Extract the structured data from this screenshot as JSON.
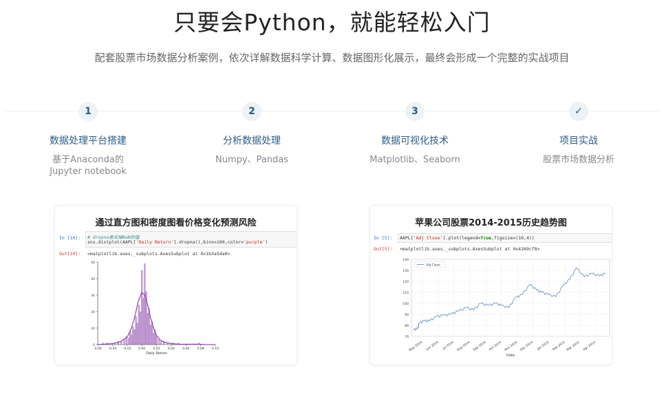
{
  "hero": {
    "title": "只要会Python，就能轻松入门",
    "subtitle": "配套股票市场数据分析案例，依次详解数据科学计算、数据图形化展示，最终会形成一个完整的实战项目"
  },
  "steps": [
    {
      "badge": "1",
      "title": "数据处理平台搭建",
      "desc_line1": "基于Anaconda的",
      "desc_line2": "Jupyter notebook"
    },
    {
      "badge": "2",
      "title": "分析数据处理",
      "desc_line1": "Numpy、Pandas",
      "desc_line2": ""
    },
    {
      "badge": "3",
      "title": "数据可视化技术",
      "desc_line1": "Matplotlib、Seaborn",
      "desc_line2": ""
    },
    {
      "badge": "✓",
      "title": "项目实战",
      "desc_line1": "股票市场数据分析",
      "desc_line2": ""
    }
  ],
  "cards": [
    {
      "title": "通过直方图和密度图看价格变化预测风险",
      "in_label": "In [10]:",
      "comment": "# dropna舍去掉NaN的值",
      "code_pre": "sns.distplot(AAPL[",
      "code_str": "'Daily Return'",
      "code_post": "].dropna(),bins=100,color=",
      "code_str2": "'purple'",
      "code_end": ")",
      "out_label": "Out[10]:",
      "out_text": "<matplotlib.axes._subplots.AxesSubplot at 0x1b3a5da0>"
    },
    {
      "title": "苹果公司股票2014-2015历史趋势图",
      "in_label": "In [5]:",
      "code_pre": "AAPL[",
      "code_str": "'Adj Close'",
      "code_post": "].plot(legend=",
      "code_kw": "True",
      "code_end": ",figsize=(10,4))",
      "out_label": "Out[5]:",
      "out_text": "<matplotlib.axes._subplots.AxesSubplot at 0x4269cf8>"
    }
  ],
  "chart_data": [
    {
      "type": "bar",
      "xlabel": "Daily Return",
      "ylabel": "",
      "xlim": [
        -0.06,
        0.1
      ],
      "ylim": [
        0,
        50
      ],
      "x_ticks": [
        "-0.06",
        "-0.04",
        "-0.02",
        "0.00",
        "0.02",
        "0.04",
        "0.06",
        "0.08",
        "0.10"
      ],
      "y_ticks": [
        "0",
        "10",
        "20",
        "30",
        "40",
        "50"
      ],
      "color": "#9b59b6",
      "bins": [
        {
          "x": -0.053,
          "y": 1
        },
        {
          "x": -0.047,
          "y": 1
        },
        {
          "x": -0.037,
          "y": 1
        },
        {
          "x": -0.032,
          "y": 2
        },
        {
          "x": -0.028,
          "y": 2
        },
        {
          "x": -0.024,
          "y": 3
        },
        {
          "x": -0.021,
          "y": 5
        },
        {
          "x": -0.018,
          "y": 4
        },
        {
          "x": -0.016,
          "y": 8
        },
        {
          "x": -0.014,
          "y": 6
        },
        {
          "x": -0.012,
          "y": 11
        },
        {
          "x": -0.01,
          "y": 9
        },
        {
          "x": -0.008,
          "y": 17
        },
        {
          "x": -0.006,
          "y": 13
        },
        {
          "x": -0.004,
          "y": 24
        },
        {
          "x": -0.002,
          "y": 20
        },
        {
          "x": 0.0,
          "y": 45
        },
        {
          "x": 0.002,
          "y": 28
        },
        {
          "x": 0.004,
          "y": 49
        },
        {
          "x": 0.006,
          "y": 32
        },
        {
          "x": 0.008,
          "y": 19
        },
        {
          "x": 0.01,
          "y": 22
        },
        {
          "x": 0.012,
          "y": 12
        },
        {
          "x": 0.014,
          "y": 14
        },
        {
          "x": 0.016,
          "y": 7
        },
        {
          "x": 0.018,
          "y": 9
        },
        {
          "x": 0.02,
          "y": 5
        },
        {
          "x": 0.023,
          "y": 3
        },
        {
          "x": 0.026,
          "y": 2
        },
        {
          "x": 0.03,
          "y": 2
        },
        {
          "x": 0.035,
          "y": 1
        },
        {
          "x": 0.042,
          "y": 1
        },
        {
          "x": 0.05,
          "y": 1
        },
        {
          "x": 0.078,
          "y": 1
        }
      ],
      "kde": [
        {
          "x": -0.06,
          "y": 0
        },
        {
          "x": -0.04,
          "y": 0.6
        },
        {
          "x": -0.03,
          "y": 1.6
        },
        {
          "x": -0.02,
          "y": 4.5
        },
        {
          "x": -0.015,
          "y": 9
        },
        {
          "x": -0.01,
          "y": 16
        },
        {
          "x": -0.005,
          "y": 26
        },
        {
          "x": 0.0,
          "y": 31.5
        },
        {
          "x": 0.004,
          "y": 30
        },
        {
          "x": 0.008,
          "y": 24
        },
        {
          "x": 0.012,
          "y": 16
        },
        {
          "x": 0.016,
          "y": 10
        },
        {
          "x": 0.02,
          "y": 5.5
        },
        {
          "x": 0.025,
          "y": 2.8
        },
        {
          "x": 0.03,
          "y": 1.5
        },
        {
          "x": 0.04,
          "y": 0.6
        },
        {
          "x": 0.05,
          "y": 0.3
        },
        {
          "x": 0.06,
          "y": 0.2
        },
        {
          "x": 0.075,
          "y": 0.3
        },
        {
          "x": 0.085,
          "y": 0.1
        },
        {
          "x": 0.1,
          "y": 0
        }
      ]
    },
    {
      "type": "line",
      "xlabel": "Date",
      "ylabel": "",
      "ylim": [
        70,
        140
      ],
      "y_ticks": [
        "70",
        "80",
        "90",
        "100",
        "110",
        "120",
        "130",
        "140"
      ],
      "x_ticks": [
        "May 2014",
        "Jun 2014",
        "Jul 2014",
        "Aug 2014",
        "Sep 2014",
        "Oct 2014",
        "Nov 2014",
        "Dec 2014",
        "Jan 2015",
        "Feb 2015",
        "Mar 2015",
        "Apr 2015"
      ],
      "legend": "top-left",
      "color": "#7a9cc6",
      "series": [
        {
          "name": "Adj Close",
          "values": [
            {
              "x": "2014-04-14",
              "y": 76
            },
            {
              "x": "2014-04-22",
              "y": 77
            },
            {
              "x": "2014-04-25",
              "y": 82
            },
            {
              "x": "2014-05-05",
              "y": 84
            },
            {
              "x": "2014-05-15",
              "y": 84
            },
            {
              "x": "2014-05-28",
              "y": 88
            },
            {
              "x": "2014-06-10",
              "y": 89
            },
            {
              "x": "2014-06-25",
              "y": 90
            },
            {
              "x": "2014-07-10",
              "y": 93
            },
            {
              "x": "2014-07-25",
              "y": 96
            },
            {
              "x": "2014-08-08",
              "y": 94
            },
            {
              "x": "2014-08-22",
              "y": 100
            },
            {
              "x": "2014-09-05",
              "y": 98
            },
            {
              "x": "2014-09-20",
              "y": 100
            },
            {
              "x": "2014-10-01",
              "y": 98
            },
            {
              "x": "2014-10-15",
              "y": 96
            },
            {
              "x": "2014-10-28",
              "y": 105
            },
            {
              "x": "2014-11-10",
              "y": 108
            },
            {
              "x": "2014-11-25",
              "y": 117
            },
            {
              "x": "2014-12-08",
              "y": 112
            },
            {
              "x": "2014-12-18",
              "y": 110
            },
            {
              "x": "2014-12-30",
              "y": 108
            },
            {
              "x": "2015-01-14",
              "y": 106
            },
            {
              "x": "2015-01-28",
              "y": 116
            },
            {
              "x": "2015-02-10",
              "y": 122
            },
            {
              "x": "2015-02-23",
              "y": 132
            },
            {
              "x": "2015-03-10",
              "y": 124
            },
            {
              "x": "2015-03-24",
              "y": 127
            },
            {
              "x": "2015-04-08",
              "y": 125
            },
            {
              "x": "2015-04-20",
              "y": 127
            }
          ]
        }
      ]
    }
  ]
}
